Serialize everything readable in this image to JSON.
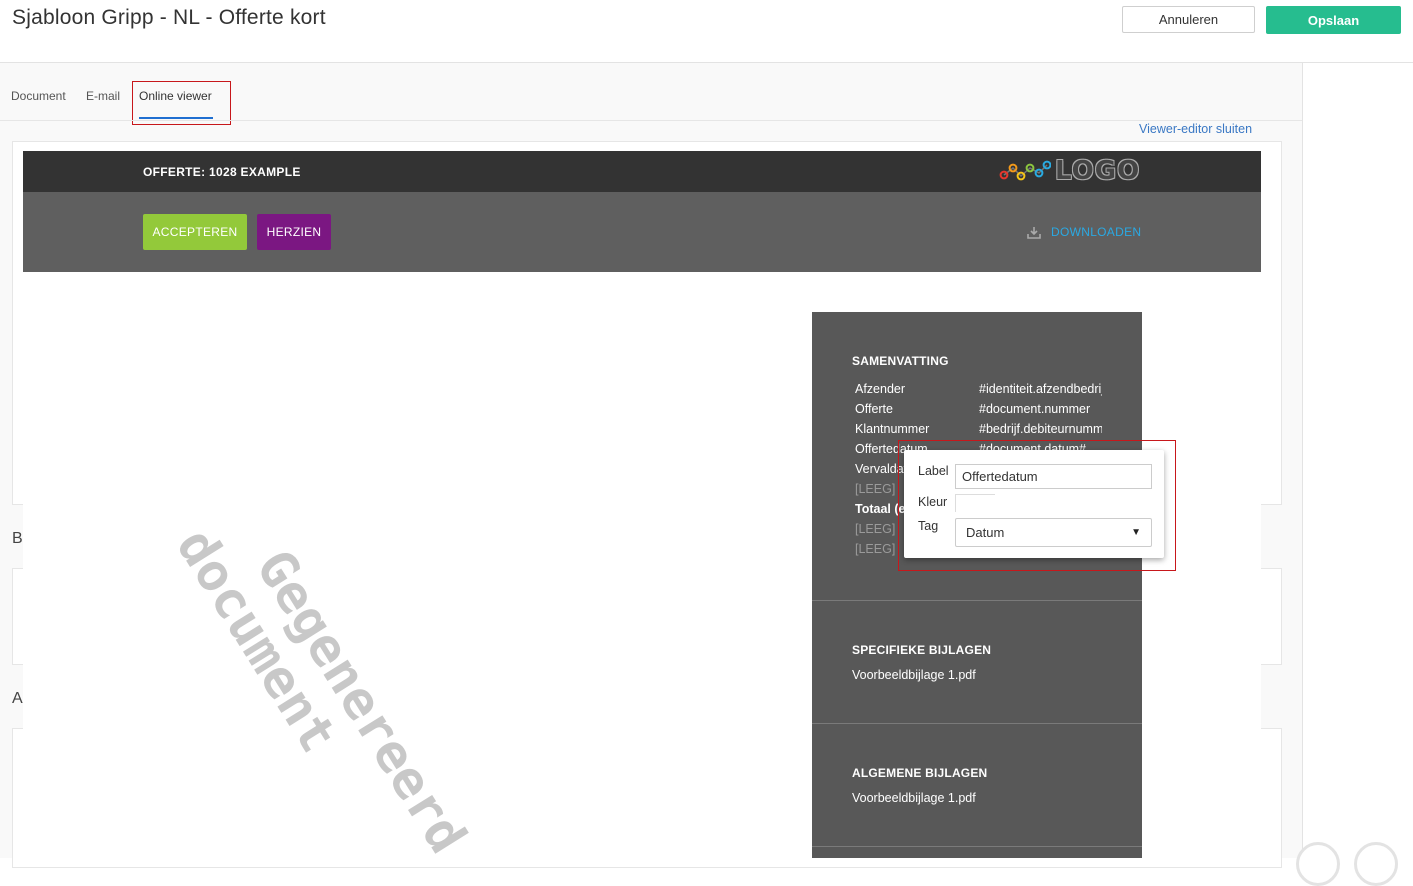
{
  "header": {
    "title": "Sjabloon Gripp - NL - Offerte kort",
    "cancel_label": "Annuleren",
    "save_label": "Opslaan"
  },
  "tabs": [
    {
      "label": "Document"
    },
    {
      "label": "E-mail"
    },
    {
      "label": "Online viewer",
      "active": true
    }
  ],
  "close_viewer_label": "Viewer-editor sluiten",
  "background_letters": [
    "B",
    "A"
  ],
  "viewer": {
    "offer_title": "OFFERTE: 1028 EXAMPLE",
    "logo_text": "LOGO",
    "accept_label": "ACCEPTEREN",
    "review_label": "HERZIEN",
    "download_label": "DOWNLOADEN",
    "watermark_line1": "Gegenereerd",
    "watermark_line2": "document",
    "summary": {
      "heading": "SAMENVATTING",
      "rows": [
        {
          "label": "Afzender",
          "value": "#identiteit.afzendbedrijf"
        },
        {
          "label": "Offerte",
          "value": "#document.nummer"
        },
        {
          "label": "Klantnummer",
          "value": "#bedrijf.debiteurnummer"
        },
        {
          "label": "Offertedatum",
          "value": "#document.datum#"
        },
        {
          "label": "Vervaldatum",
          "value": ""
        },
        {
          "label": "[LEEG]",
          "value": ""
        },
        {
          "label": "Totaal (e",
          "value": ""
        },
        {
          "label": "[LEEG]",
          "value": ""
        },
        {
          "label": "[LEEG]",
          "value": ""
        }
      ],
      "specific_heading": "SPECIFIEKE BIJLAGEN",
      "specific_file": "Voorbeeldbijlage 1.pdf",
      "general_heading": "ALGEMENE BIJLAGEN",
      "general_file": "Voorbeeldbijlage 1.pdf"
    }
  },
  "popup": {
    "label_label": "Label",
    "label_value": "Offertedatum",
    "color_label": "Kleur",
    "tag_label": "Tag",
    "tag_value": "Datum"
  },
  "colors": {
    "save": "#26bd8f",
    "accept": "#93c93a",
    "review": "#7b1782",
    "download": "#2aa9e3",
    "link": "#3a78c4",
    "highlight": "#c7171b"
  }
}
